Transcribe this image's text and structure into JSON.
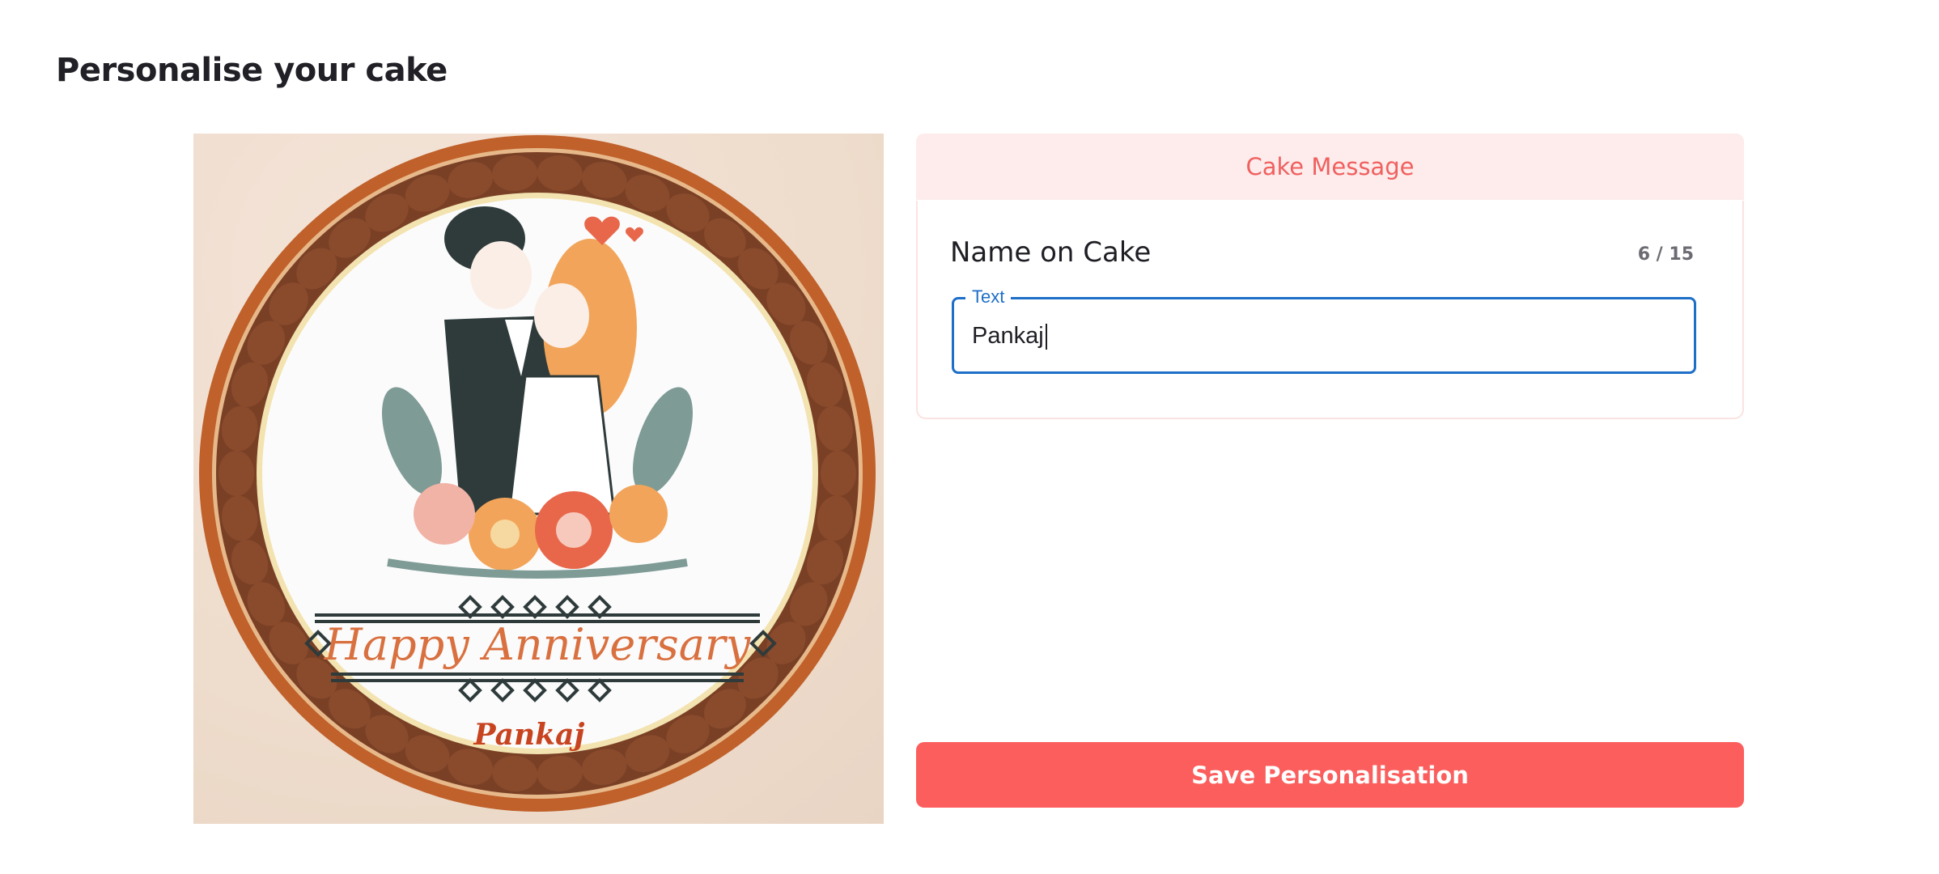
{
  "page": {
    "title": "Personalise your cake"
  },
  "preview": {
    "cake_banner_text": "Happy Anniversary",
    "cake_name_text": "Pankaj"
  },
  "tabs": [
    {
      "label": "Cake Message",
      "active": true
    }
  ],
  "message_form": {
    "field_title": "Name on Cake",
    "char_count": "6 / 15",
    "input_label": "Text",
    "input_value": "Pankaj"
  },
  "actions": {
    "save_label": "Save Personalisation"
  },
  "colors": {
    "accent": "#fb5e5c",
    "tab_bg": "#fdeceb",
    "tab_text": "#f0605f",
    "input_focus": "#1e6fc7"
  }
}
